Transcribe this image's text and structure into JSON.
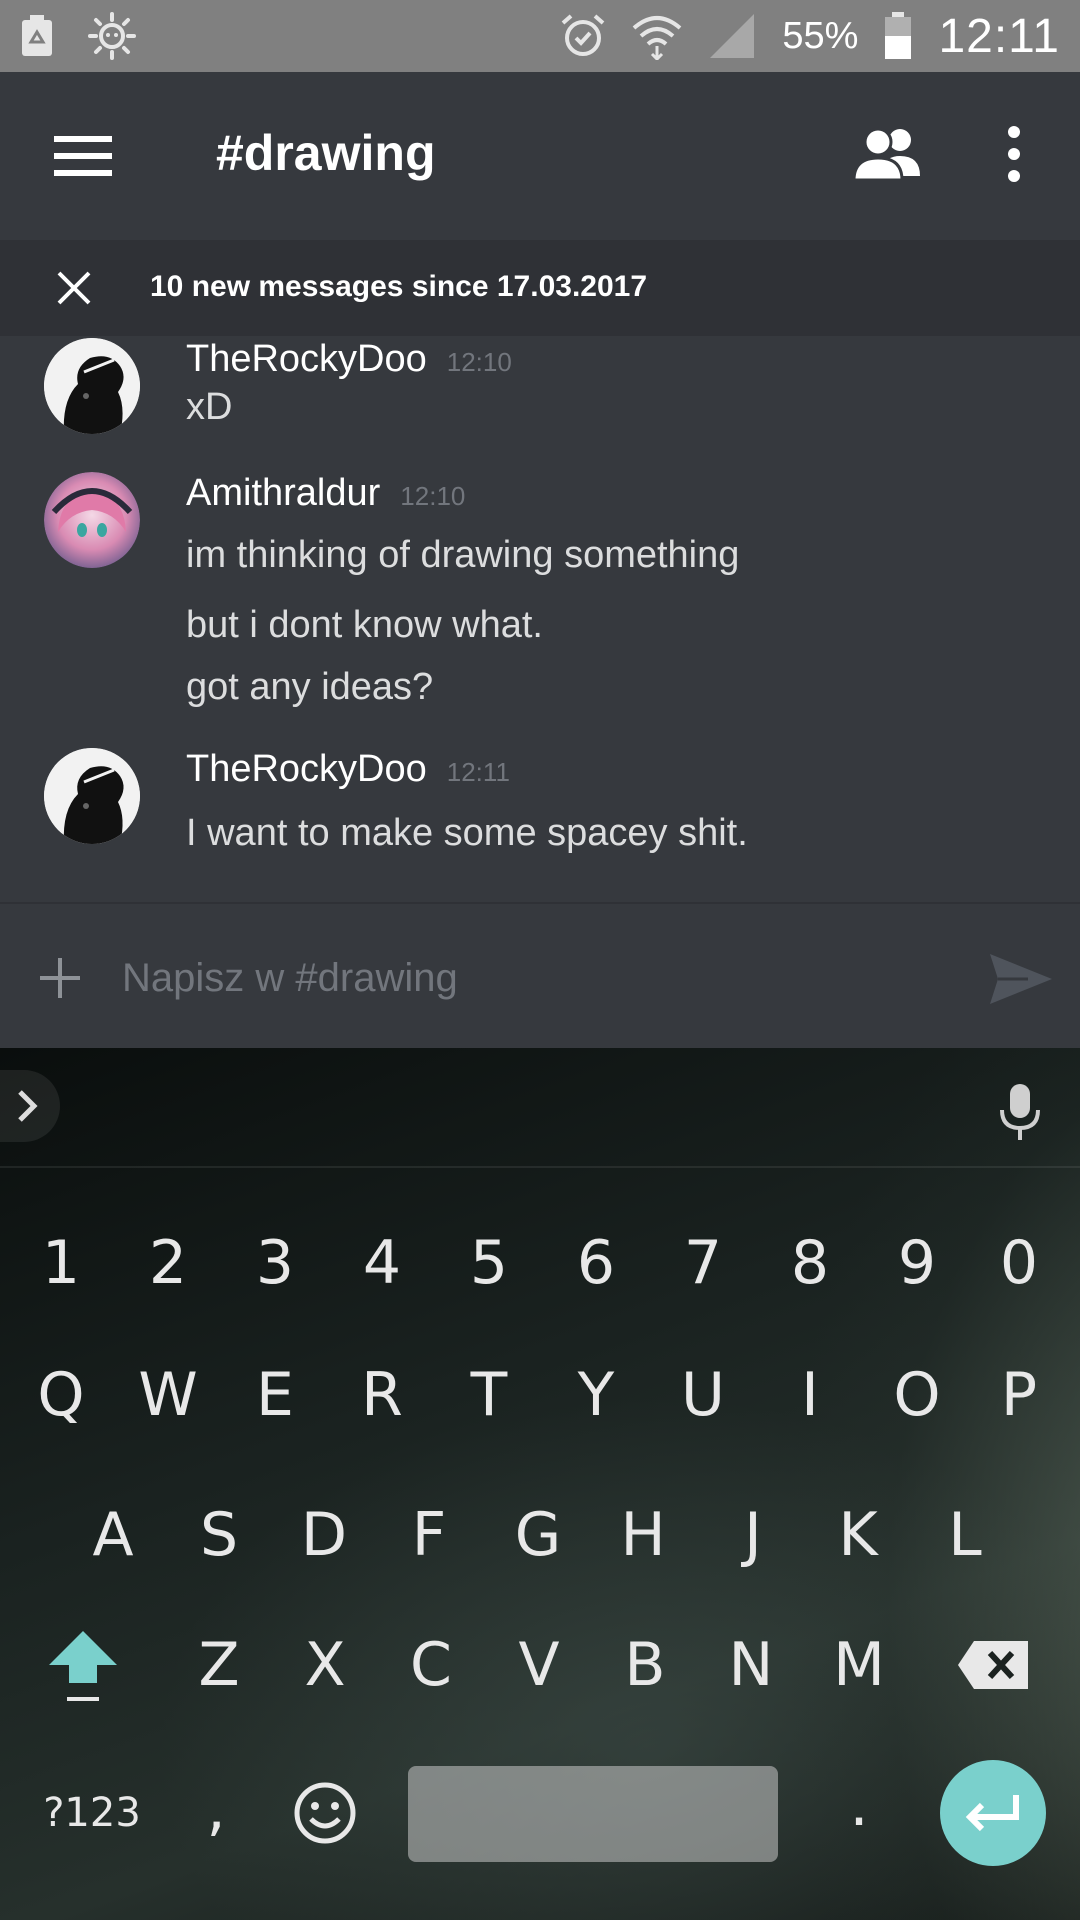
{
  "status_bar": {
    "battery_percent": "55%",
    "time": "12:11",
    "icons": [
      "recycle-icon",
      "brightness-icon",
      "alarm-icon",
      "wifi-icon",
      "signal-icon",
      "battery-icon"
    ]
  },
  "app_bar": {
    "channel": "#drawing",
    "icons": [
      "menu-icon",
      "members-icon",
      "overflow-icon"
    ]
  },
  "new_messages_banner": {
    "text": "10 new messages since 17.03.2017"
  },
  "messages": [
    {
      "author": "TheRockyDoo",
      "time": "12:10",
      "lines": [
        "xD"
      ]
    },
    {
      "author": "Amithraldur",
      "time": "12:10",
      "lines": [
        "im thinking of drawing something",
        "but i dont know what.",
        "got any ideas?"
      ]
    },
    {
      "author": "TheRockyDoo",
      "time": "12:11",
      "lines": [
        "I want to make some spacey shit."
      ]
    }
  ],
  "composer": {
    "placeholder": "Napisz w #drawing"
  },
  "keyboard": {
    "number_row": [
      "1",
      "2",
      "3",
      "4",
      "5",
      "6",
      "7",
      "8",
      "9",
      "0"
    ],
    "row1": [
      "Q",
      "W",
      "E",
      "R",
      "T",
      "Y",
      "U",
      "I",
      "O",
      "P"
    ],
    "row2": [
      "A",
      "S",
      "D",
      "F",
      "G",
      "H",
      "J",
      "K",
      "L"
    ],
    "row3": [
      "Z",
      "X",
      "C",
      "V",
      "B",
      "N",
      "M"
    ],
    "symbols_label": "?123",
    "comma": ",",
    "period": ".",
    "accent_color": "#7ad0cc"
  },
  "colors": {
    "background": "#36393e",
    "banner": "#2f3136",
    "timestamp": "#72767d"
  }
}
